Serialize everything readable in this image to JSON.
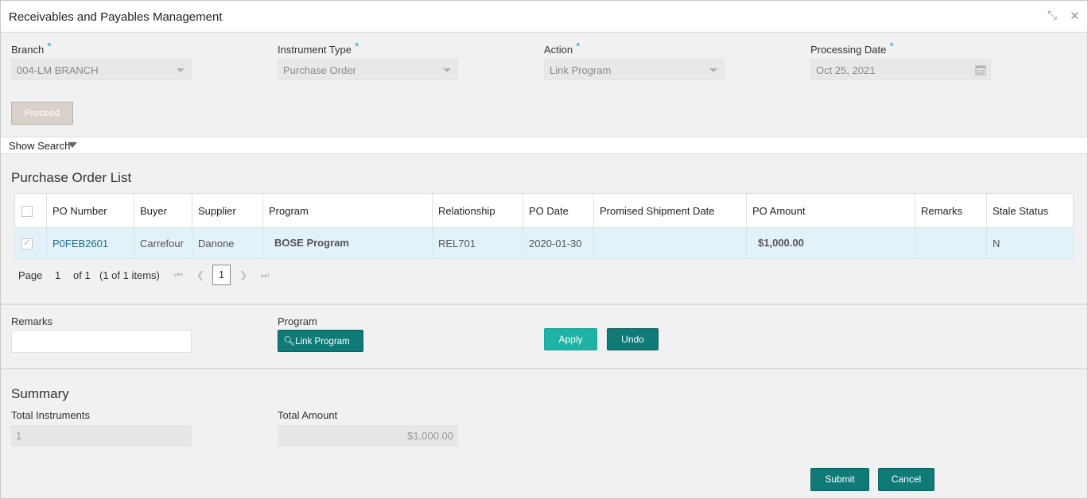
{
  "window": {
    "title": "Receivables and Payables Management"
  },
  "form": {
    "branch": {
      "label": "Branch",
      "value": "004-LM BRANCH"
    },
    "instrument_type": {
      "label": "Instrument Type",
      "value": "Purchase Order"
    },
    "action": {
      "label": "Action",
      "value": "Link Program"
    },
    "processing_date": {
      "label": "Processing Date",
      "value": "Oct 25, 2021"
    },
    "required_mark": "*",
    "proceed_label": "Proceed"
  },
  "show_search": {
    "label": "Show Search"
  },
  "po_list": {
    "title": "Purchase Order List",
    "columns": [
      "PO Number",
      "Buyer",
      "Supplier",
      "Program",
      "Relationship",
      "PO Date",
      "Promised Shipment Date",
      "PO Amount",
      "Remarks",
      "Stale Status"
    ],
    "rows": [
      {
        "po_number": "P0FEB2601",
        "buyer": "Carrefour",
        "supplier": "Danone",
        "program": "BOSE Program",
        "relationship": "REL701",
        "po_date": "2020-01-30",
        "promised_shipment_date": "",
        "po_amount": "$1,000.00",
        "remarks": "",
        "stale_status": "N"
      }
    ],
    "pager": {
      "page_label": "Page",
      "page": "1",
      "of_label": "of 1",
      "items_label": "(1 of 1 items)",
      "current": "1"
    }
  },
  "actions": {
    "remarks_label": "Remarks",
    "remarks_value": "",
    "program_label": "Program",
    "link_program_label": "Link Program",
    "apply_label": "Apply",
    "undo_label": "Undo"
  },
  "summary": {
    "title": "Summary",
    "total_instruments_label": "Total Instruments",
    "total_instruments_value": "1",
    "total_amount_label": "Total Amount",
    "total_amount_value": "$1,000.00"
  },
  "footer": {
    "submit_label": "Submit",
    "cancel_label": "Cancel"
  },
  "colors": {
    "accent_teal": "#0f7a76",
    "apply_teal": "#1fb3a7",
    "required_star": "#2aa6c8",
    "link_blue": "#1f6e8c"
  }
}
